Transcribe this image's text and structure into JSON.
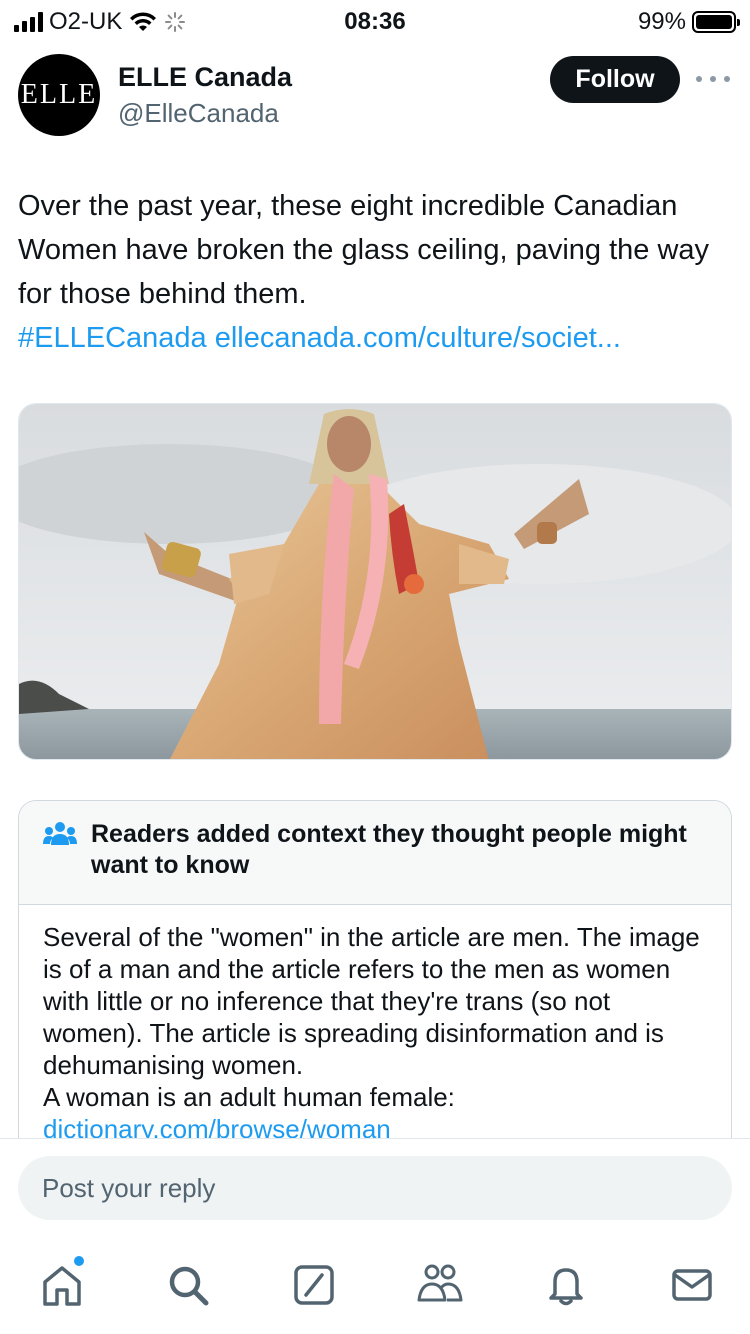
{
  "status_bar": {
    "carrier": "O2-UK",
    "time": "08:36",
    "battery_percent": "99%",
    "battery_level": 0.99
  },
  "tweet": {
    "avatar_text": "ELLE",
    "display_name": "ELLE Canada",
    "handle": "@ElleCanada",
    "follow_label": "Follow",
    "text": "Over the past year, these eight incredible Canadian Women have broken the glass ceiling, paving the way for those behind them.",
    "hashtag": "#ELLECanada",
    "url": "ellecanada.com/culture/societ..."
  },
  "community_note": {
    "title": "Readers added context they thought people might want to know",
    "body": "Several of the \"women\" in the article are men. The image is of a man and the article refers to the men as women with little or no inference that they're trans (so not women). The article is spreading disinformation and is dehumanising women.",
    "body_line2": "A woman is an adult human female:",
    "link": "dictionary.com/browse/woman"
  },
  "reply": {
    "placeholder": "Post your reply"
  },
  "tab_bar": {
    "icons": [
      "home-icon",
      "search-icon",
      "grok-icon",
      "communities-icon",
      "notifications-icon",
      "messages-icon"
    ]
  },
  "colors": {
    "accent": "#1d9bf0",
    "text_primary": "#0f1419",
    "text_secondary": "#536471",
    "button_dark": "#0f1419"
  }
}
